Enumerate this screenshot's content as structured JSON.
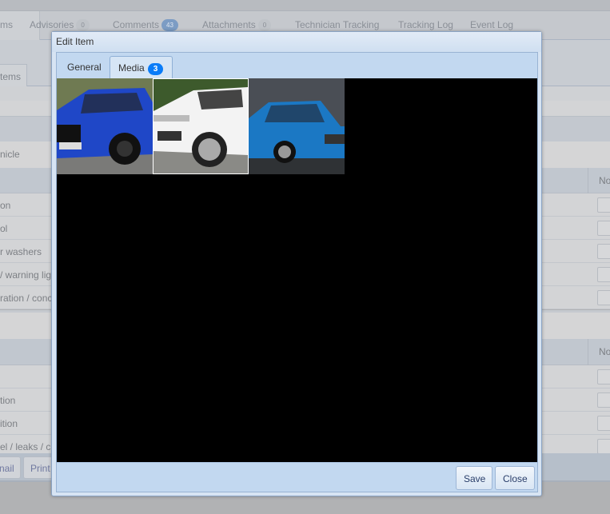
{
  "background": {
    "tabs": [
      {
        "label": "ms"
      },
      {
        "label": "Advisories",
        "badge": "0"
      },
      {
        "label": "Comments",
        "badge": "43"
      },
      {
        "label": "Attachments",
        "badge": "0"
      },
      {
        "label": "Technician Tracking"
      },
      {
        "label": "Tracking Log"
      },
      {
        "label": "Event Log"
      }
    ],
    "subtab": "tems",
    "section_label": "nicle",
    "column_header": "No",
    "section1_rows": [
      "on",
      "ol",
      "r washers",
      "/ warning lig",
      "ration / conc"
    ],
    "section2_rows": [
      "",
      "tion",
      "ition",
      "el / leaks / c"
    ],
    "buttons": [
      "nail",
      "Print"
    ]
  },
  "dialog": {
    "title": "Edit Item",
    "tabs": [
      {
        "label": "General"
      },
      {
        "label": "Media",
        "badge": "3"
      }
    ],
    "active_tab": "Media",
    "media": [
      {
        "icon": "blue-bmw-photo",
        "color": "#1f47c7"
      },
      {
        "icon": "white-range-rover-photo",
        "color": "#f3f3f3"
      },
      {
        "icon": "blue-mercedes-photo",
        "color": "#1b78c4"
      }
    ],
    "selected_media": 2,
    "save_label": "Save",
    "close_label": "Close"
  }
}
